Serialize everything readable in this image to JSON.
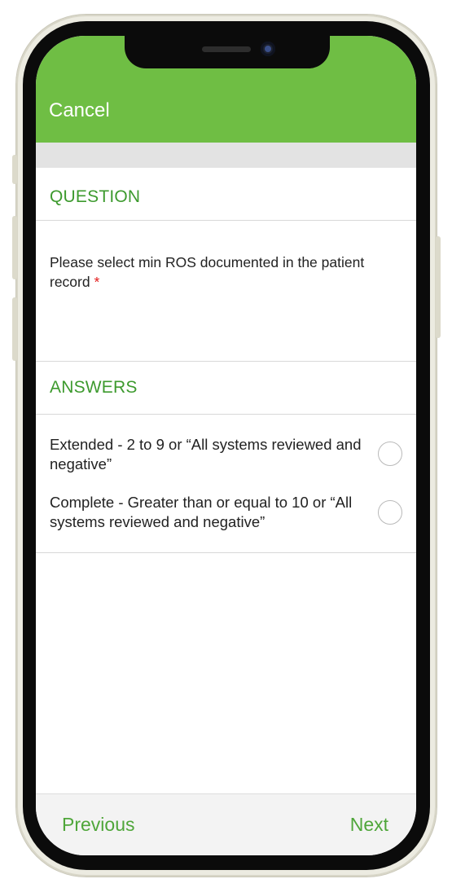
{
  "header": {
    "cancel_label": "Cancel"
  },
  "question": {
    "section_title": "QUESTION",
    "text": "Please select min ROS documented in the patient record",
    "required_marker": "*"
  },
  "answers": {
    "section_title": "ANSWERS",
    "options": [
      {
        "label": "Extended - 2 to 9 or “All systems reviewed and negative”",
        "selected": false
      },
      {
        "label": "Complete - Greater than or equal to 10 or “All systems reviewed and negative”",
        "selected": false
      }
    ]
  },
  "footer": {
    "previous_label": "Previous",
    "next_label": "Next"
  },
  "colors": {
    "header": "#6fbe44",
    "accent_text": "#3d9a2e",
    "required": "#e31b1b"
  }
}
